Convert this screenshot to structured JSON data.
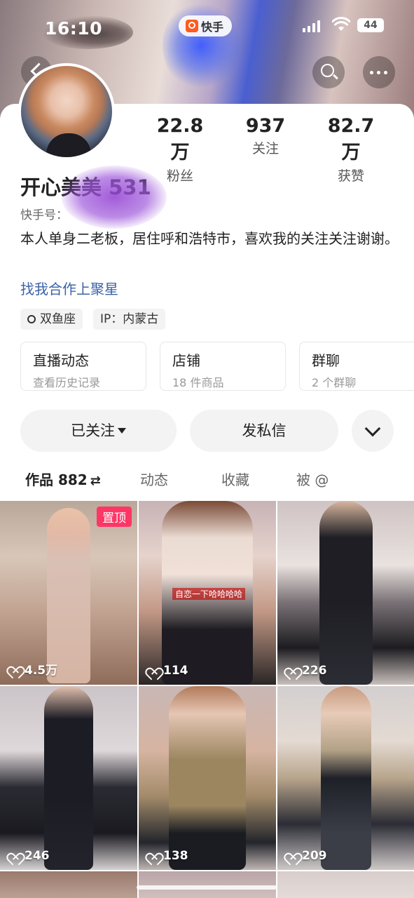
{
  "status_bar": {
    "time": "16:10",
    "app_name": "快手",
    "battery": "44"
  },
  "profile": {
    "name": "开心美美 531",
    "kuaishou_id_label": "快手号：",
    "bio": "本人单身二老板，居住呼和浩特市，喜欢我的关注关注谢谢。",
    "link": "找我合作上聚星",
    "tags": [
      "双鱼座",
      "IP：内蒙古"
    ]
  },
  "stats": [
    {
      "value": "22.8万",
      "label": "粉丝"
    },
    {
      "value": "937",
      "label": "关注"
    },
    {
      "value": "82.7万",
      "label": "获赞"
    }
  ],
  "features": [
    {
      "title": "直播动态",
      "subtitle": "查看历史记录"
    },
    {
      "title": "店铺",
      "subtitle": "18 件商品"
    },
    {
      "title": "群聊",
      "subtitle": "2 个群聊"
    }
  ],
  "actions": {
    "follow": "已关注",
    "message": "发私信"
  },
  "tabs": [
    "作品 882",
    "动态",
    "收藏",
    "被 @"
  ],
  "tab_swap_symbol": "⇄",
  "videos": [
    {
      "likes": "4.5万",
      "pinned_label": "置顶"
    },
    {
      "likes": "114",
      "caption": "自恋一下哈哈哈哈"
    },
    {
      "likes": "226"
    },
    {
      "likes": "246"
    },
    {
      "likes": "138"
    },
    {
      "likes": "209"
    }
  ],
  "icons": [
    "back-icon",
    "search-icon",
    "more-icon",
    "chevron-down-icon",
    "heart-icon",
    "constellation-icon"
  ]
}
